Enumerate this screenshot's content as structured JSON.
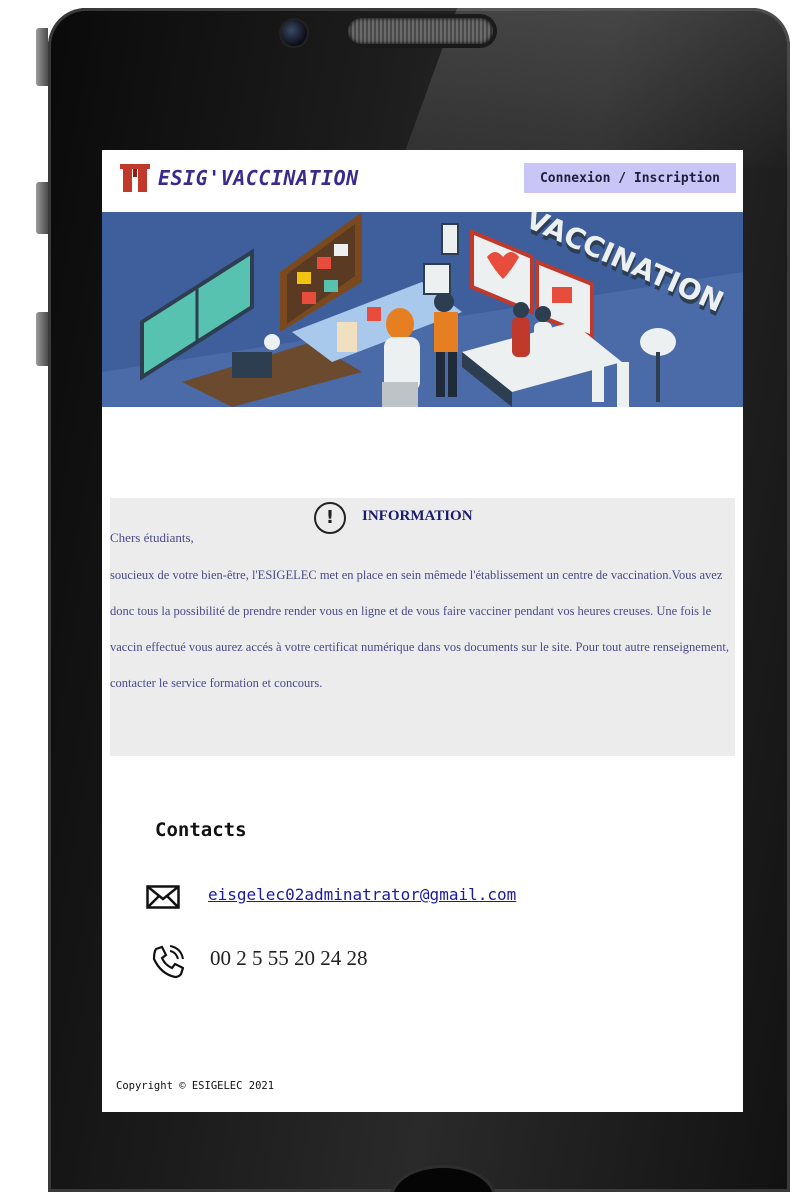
{
  "header": {
    "brand": "ESIG'VACCINATION",
    "login_label": "Connexion / Inscription"
  },
  "banner": {
    "text": "VACCINATION"
  },
  "info": {
    "icon": "exclamation-circle-icon",
    "title": "INFORMATION",
    "greeting": "Chers étudiants,",
    "body": "soucieux de votre bien-être, l'ESIGELEC met en place en sein mêmede l'établissement un centre de vaccination.Vous avez donc tous la possibilité de prendre render vous en ligne et de vous faire vacciner pendant vos heures creuses. Une fois le vaccin effectué vous aurez accés à votre certificat numérique dans vos documents sur le site. Pour tout autre renseignement, contacter le service formation et concours."
  },
  "contacts": {
    "title": "Contacts",
    "email": "eisgelec02adminatrator@gmail.com",
    "phone": "00 2 5 55 20 24 28"
  },
  "footer": {
    "copyright": "Copyright © ESIGELEC 2021"
  },
  "colors": {
    "brand": "#3b2a8c",
    "login_bg": "#c9c6f7",
    "banner_bg": "#3f5f9c",
    "info_bg": "#ececec",
    "info_text": "#4a4a8c",
    "link": "#1a1aa6"
  }
}
